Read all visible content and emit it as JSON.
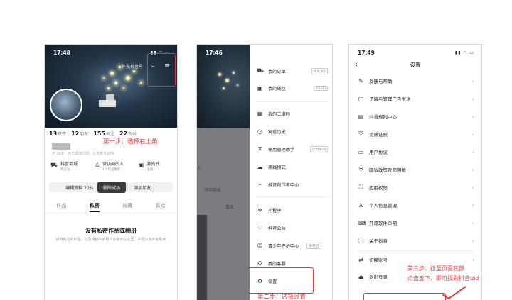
{
  "phone1": {
    "time": "17:48",
    "hero_hint": "补充抖音号",
    "stats": [
      {
        "num": "13",
        "label": "获赞"
      },
      {
        "num": "12",
        "label": "朋友"
      },
      {
        "num": "155",
        "label": "关注"
      },
      {
        "num": "22",
        "label": "粉丝"
      }
    ],
    "bio": "♂ 26岁 · 点击添加介绍，让大家认识你",
    "quick": [
      {
        "title": "抖音商城",
        "sub": "购买过"
      },
      {
        "title": "常访问的人",
        "sub": "1个作品更新"
      },
      {
        "title": "我的钱",
        "sub": "查看"
      }
    ],
    "buttons": [
      "编辑资料 70%",
      "添加朋友"
    ],
    "toast": "删除成功",
    "tabs": [
      "作品",
      "私密",
      "收藏",
      "喜欢"
    ],
    "active_tab": "私密",
    "empty_title": "没有私密作品或相册",
    "empty_sub": "设为私密的作品，以及相册中的照片会展示在这里，并且只有你能看到"
  },
  "phone2": {
    "time": "17:46",
    "left_frags": [
      "人",
      "添加朋友",
      "喜欢"
    ],
    "menu": [
      {
        "icon": "cart-icon",
        "label": "我的订单",
        "tag": "待发货2"
      },
      {
        "icon": "wallet-icon",
        "label": "我的钱包",
        "tag": "¥0.00"
      },
      {
        "icon": "qrcode-icon",
        "label": "我的二维码",
        "tag": ""
      },
      {
        "icon": "history-icon",
        "label": "观看历史",
        "tag": ""
      },
      {
        "icon": "timer-icon",
        "label": "使用管理助手",
        "tag": "定时关闭"
      },
      {
        "icon": "offline-icon",
        "label": "离线模式",
        "tag": ""
      },
      {
        "icon": "bulb-icon",
        "label": "抖音创作者中心",
        "tag": ""
      },
      {
        "icon": "miniapp-icon",
        "label": "小程序",
        "tag": ""
      },
      {
        "icon": "charity-icon",
        "label": "抖音公益",
        "tag": ""
      },
      {
        "icon": "teen-icon",
        "label": "青少年守护中心",
        "tag": "未开启"
      },
      {
        "icon": "service-icon",
        "label": "我的客服",
        "tag": ""
      },
      {
        "icon": "settings-icon",
        "label": "设置",
        "tag": ""
      }
    ]
  },
  "phone3": {
    "time": "17:49",
    "title": "设置",
    "items": [
      {
        "icon": "feedback-icon",
        "label": "反馈与帮助"
      },
      {
        "icon": "ad-icon",
        "label": "了解与管理广告推送"
      },
      {
        "icon": "rules-icon",
        "label": "抖音规则中心"
      },
      {
        "icon": "cert-icon",
        "label": "资质证照"
      },
      {
        "icon": "doc-icon",
        "label": "用户协议"
      },
      {
        "icon": "privacy-icon",
        "label": "隐私政策及简明版"
      },
      {
        "icon": "permission-icon",
        "label": "应用权限"
      },
      {
        "icon": "personal-info-icon",
        "label": "个人信息管理"
      },
      {
        "icon": "opensource-icon",
        "label": "开源软件声明"
      },
      {
        "icon": "about-icon",
        "label": "关于抖音"
      },
      {
        "icon": "switch-icon",
        "label": "切换账号"
      },
      {
        "icon": "logout-icon",
        "label": "退出登录"
      }
    ]
  },
  "annotations": {
    "step1": "第一步：选择右上角",
    "step2": "第二步：选择设置",
    "step3_line1": "第三步：拉至页面底部",
    "step3_line2": "点击五下，即可找到抖音uid"
  },
  "colors": {
    "annotation_red": "#e0393e"
  }
}
